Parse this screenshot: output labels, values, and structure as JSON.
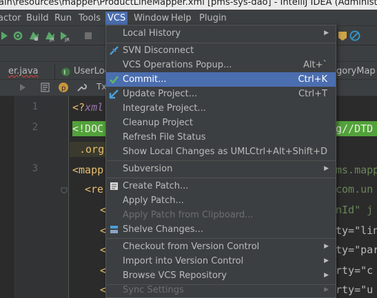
{
  "window": {
    "title": "ain\\resources\\mapper\\ProductLineMapper.xml [pms-sys-dao] - IntelliJ IDEA (Administrator)"
  },
  "menubar": {
    "items": [
      "actor",
      "Build",
      "Run",
      "Tools",
      "VCS",
      "Window",
      "Help",
      "Plugin"
    ],
    "active": "VCS"
  },
  "tabs": [
    {
      "label": "er.java"
    },
    {
      "label": "UserLog"
    },
    {
      "label": "egoryMap"
    }
  ],
  "editor": {
    "line_numbers": [
      "1",
      "2",
      "3"
    ],
    "lines": [
      {
        "a": "<?",
        "b": "xml"
      },
      {
        "a": "<!DOC",
        "b": "g//DTD"
      },
      {
        "a": ".org"
      },
      {
        "a": "<mapp",
        "b": "ms.mapp"
      },
      {
        "a": "<re",
        "b": "com.un"
      },
      {
        "a": "<",
        "b": "nId\" j"
      },
      {
        "a": "<",
        "b": "ty=\"lin"
      },
      {
        "a": "<",
        "b": "ty=\"par"
      },
      {
        "a": "<",
        "b": "rty=\"c"
      },
      {
        "a": "<",
        "b": "rty=\"u"
      }
    ]
  },
  "vcs_menu": {
    "items": [
      {
        "label": "Local History",
        "submenu": true
      },
      {
        "label": "SVN Disconnect",
        "icon": "svn-disconnect-icon"
      },
      {
        "label": "VCS Operations Popup...",
        "shortcut": "Alt+`"
      },
      {
        "label": "Commit...",
        "shortcut": "Ctrl+K",
        "icon": "commit-check-icon",
        "selected": true
      },
      {
        "label": "Update Project...",
        "shortcut": "Ctrl+T",
        "icon": "update-arrow-icon"
      },
      {
        "label": "Integrate Project..."
      },
      {
        "label": "Cleanup Project"
      },
      {
        "label": "Refresh File Status"
      },
      {
        "label": "Show Local Changes as UML",
        "shortcut": "Ctrl+Alt+Shift+D"
      },
      {
        "label": "Subversion",
        "submenu": true
      },
      {
        "label": "Create Patch...",
        "icon": "create-patch-icon"
      },
      {
        "label": "Apply Patch..."
      },
      {
        "label": "Apply Patch from Clipboard...",
        "disabled": true
      },
      {
        "label": "Shelve Changes...",
        "icon": "shelve-icon"
      },
      {
        "label": "Checkout from Version Control",
        "submenu": true
      },
      {
        "label": "Import into Version Control",
        "submenu": true
      },
      {
        "label": "Browse VCS Repository",
        "submenu": true
      },
      {
        "label": "Sync Settings",
        "submenu": true,
        "disabled": true
      }
    ]
  },
  "colors": {
    "accent": "#4b6eaf",
    "green_highlight": "#52a23a",
    "menu_bg": "#3c3f41"
  }
}
